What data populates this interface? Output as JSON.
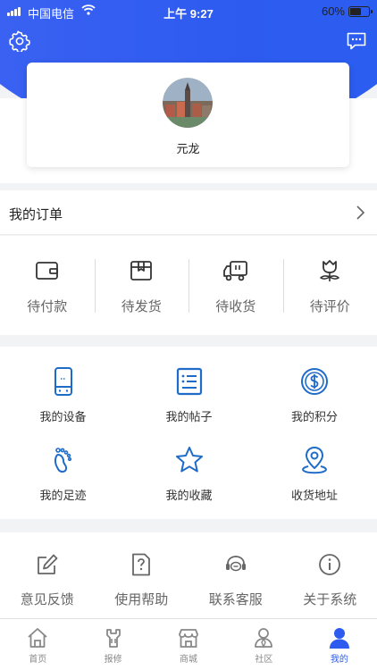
{
  "status_bar": {
    "carrier": "中国电信",
    "time": "上午 9:27",
    "battery": "60%"
  },
  "profile": {
    "username": "元龙"
  },
  "orders": {
    "title": "我的订单",
    "items": [
      {
        "label": "待付款",
        "icon": "wallet-icon"
      },
      {
        "label": "待发货",
        "icon": "package-icon"
      },
      {
        "label": "待收货",
        "icon": "truck-icon"
      },
      {
        "label": "待评价",
        "icon": "flower-icon"
      }
    ]
  },
  "services": {
    "items": [
      {
        "label": "我的设备",
        "icon": "device-icon"
      },
      {
        "label": "我的帖子",
        "icon": "post-icon"
      },
      {
        "label": "我的积分",
        "icon": "points-icon"
      },
      {
        "label": "我的足迹",
        "icon": "footprint-icon"
      },
      {
        "label": "我的收藏",
        "icon": "star-icon"
      },
      {
        "label": "收货地址",
        "icon": "location-icon"
      }
    ]
  },
  "tools": {
    "items": [
      {
        "label": "意见反馈",
        "icon": "edit-icon"
      },
      {
        "label": "使用帮助",
        "icon": "help-icon"
      },
      {
        "label": "联系客服",
        "icon": "headset-icon"
      },
      {
        "label": "关于系统",
        "icon": "info-icon"
      }
    ]
  },
  "tabbar": {
    "items": [
      {
        "label": "首页",
        "icon": "home-icon"
      },
      {
        "label": "报修",
        "icon": "repair-icon"
      },
      {
        "label": "商城",
        "icon": "shop-icon"
      },
      {
        "label": "社区",
        "icon": "community-icon"
      },
      {
        "label": "我的",
        "icon": "user-icon",
        "active": true
      }
    ]
  },
  "colors": {
    "brand_blue": "#2d5bf0",
    "icon_blue": "#1e6cc8",
    "icon_gray": "#555555"
  }
}
